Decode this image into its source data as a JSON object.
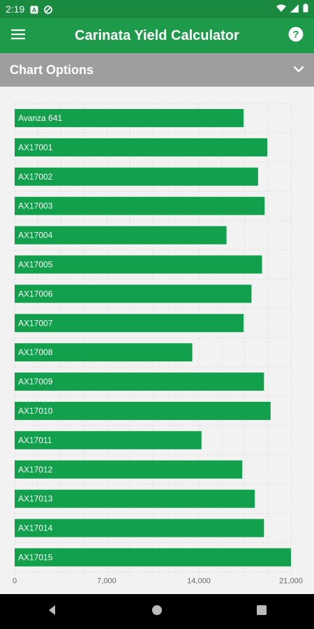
{
  "status_bar": {
    "time": "2:19",
    "icons": [
      "notification-a-icon",
      "no-tracking-icon",
      "wifi-icon",
      "signal-icon",
      "battery-icon"
    ]
  },
  "app_bar": {
    "title": "Carinata Yield Calculator",
    "menu_icon": "menu-icon",
    "help_icon": "help-icon"
  },
  "options_bar": {
    "label": "Chart Options",
    "icon": "chevron-down-icon"
  },
  "colors": {
    "app_bar": "#1e9a4b",
    "status_bar": "#1a8a41",
    "bar": "#12a04c",
    "options_bar": "#9e9e9e"
  },
  "chart_data": {
    "type": "bar",
    "orientation": "horizontal",
    "categories": [
      "Avanza 641",
      "AX17001",
      "AX17002",
      "AX17003",
      "AX17004",
      "AX17005",
      "AX17006",
      "AX17007",
      "AX17008",
      "AX17009",
      "AX17010",
      "AX17011",
      "AX17012",
      "AX17013",
      "AX17014",
      "AX17015"
    ],
    "values": [
      17400,
      19200,
      18500,
      19000,
      16100,
      18800,
      18000,
      17400,
      13500,
      18950,
      19450,
      14200,
      17300,
      18250,
      18950,
      21000
    ],
    "xlim": [
      0,
      21000
    ],
    "x_ticks": [
      "0",
      "7,000",
      "14,000",
      "21,000"
    ],
    "x_tick_values": [
      0,
      7000,
      14000,
      21000
    ],
    "grid": true
  },
  "nav_bar": {
    "icons": [
      "back-icon",
      "home-icon",
      "recents-icon"
    ]
  }
}
